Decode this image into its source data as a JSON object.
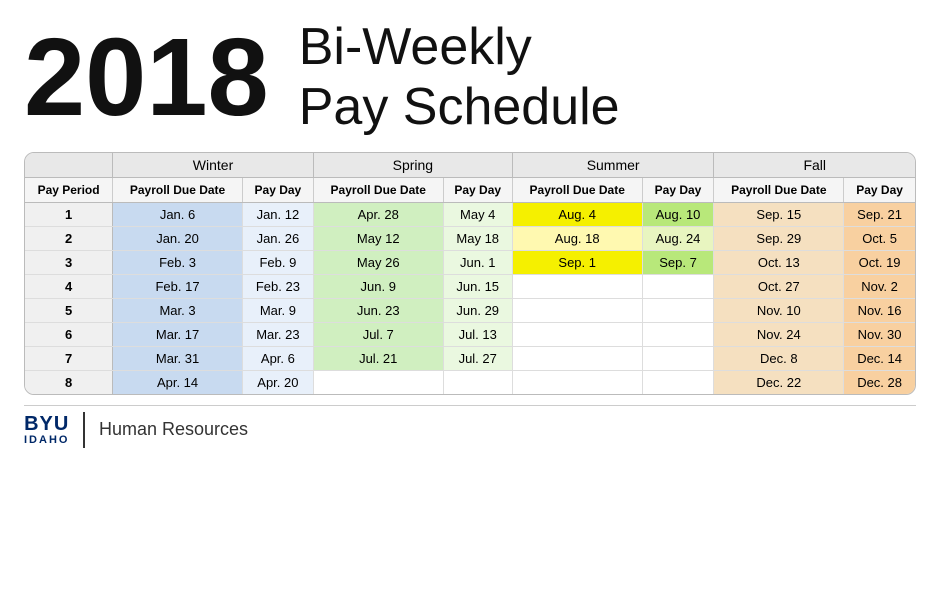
{
  "header": {
    "year": "2018",
    "title_line1": "Bi-Weekly",
    "title_line2": "Pay Schedule"
  },
  "seasons": [
    {
      "label": "Winter",
      "colspan": 2
    },
    {
      "label": "Spring",
      "colspan": 2
    },
    {
      "label": "Summer",
      "colspan": 2
    },
    {
      "label": "Fall",
      "colspan": 2
    }
  ],
  "col_headers": [
    "Pay Period",
    "Payroll Due Date",
    "Pay Day",
    "Payroll Due Date",
    "Pay Day",
    "Payroll Due Date",
    "Pay Day",
    "Payroll Due Date",
    "Pay Day"
  ],
  "rows": [
    {
      "period": "1",
      "w_due": "Jan. 6",
      "w_pay": "Jan. 12",
      "sp_due": "Apr. 28",
      "sp_pay": "May 4",
      "su_due": "Aug. 4",
      "su_pay": "Aug. 10",
      "f_due": "Sep. 15",
      "f_pay": "Sep. 21"
    },
    {
      "period": "2",
      "w_due": "Jan. 20",
      "w_pay": "Jan. 26",
      "sp_due": "May 12",
      "sp_pay": "May 18",
      "su_due": "Aug. 18",
      "su_pay": "Aug. 24",
      "f_due": "Sep. 29",
      "f_pay": "Oct. 5"
    },
    {
      "period": "3",
      "w_due": "Feb. 3",
      "w_pay": "Feb. 9",
      "sp_due": "May 26",
      "sp_pay": "Jun. 1",
      "su_due": "Sep. 1",
      "su_pay": "Sep. 7",
      "f_due": "Oct. 13",
      "f_pay": "Oct. 19"
    },
    {
      "period": "4",
      "w_due": "Feb. 17",
      "w_pay": "Feb. 23",
      "sp_due": "Jun. 9",
      "sp_pay": "Jun. 15",
      "su_due": "",
      "su_pay": "",
      "f_due": "Oct. 27",
      "f_pay": "Nov. 2"
    },
    {
      "period": "5",
      "w_due": "Mar. 3",
      "w_pay": "Mar. 9",
      "sp_due": "Jun. 23",
      "sp_pay": "Jun. 29",
      "su_due": "",
      "su_pay": "",
      "f_due": "Nov. 10",
      "f_pay": "Nov. 16"
    },
    {
      "period": "6",
      "w_due": "Mar. 17",
      "w_pay": "Mar. 23",
      "sp_due": "Jul. 7",
      "sp_pay": "Jul. 13",
      "su_due": "",
      "su_pay": "",
      "f_due": "Nov. 24",
      "f_pay": "Nov. 30"
    },
    {
      "period": "7",
      "w_due": "Mar. 31",
      "w_pay": "Apr. 6",
      "sp_due": "Jul. 21",
      "sp_pay": "Jul. 27",
      "su_due": "",
      "su_pay": "",
      "f_due": "Dec. 8",
      "f_pay": "Dec. 14"
    },
    {
      "period": "8",
      "w_due": "Apr. 14",
      "w_pay": "Apr. 20",
      "sp_due": "",
      "sp_pay": "",
      "su_due": "",
      "su_pay": "",
      "f_due": "Dec. 22",
      "f_pay": "Dec. 28"
    }
  ],
  "footer": {
    "byu": "BYU",
    "idaho": "IDAHO",
    "hr": "Human Resources"
  }
}
